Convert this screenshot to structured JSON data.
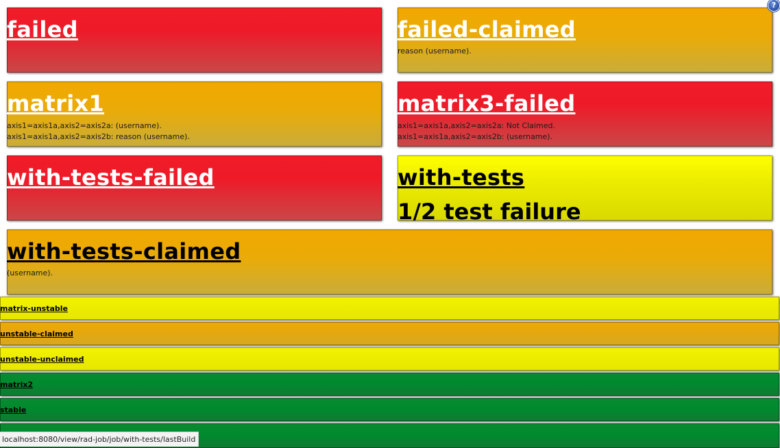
{
  "help_icon": {
    "glyph": "?"
  },
  "big_tiles": [
    {
      "name": "failed",
      "color": "red",
      "claims": []
    },
    {
      "name": "failed-claimed",
      "color": "orange",
      "claims": [
        "reason (username)."
      ]
    },
    {
      "name": "matrix1",
      "color": "orange",
      "claims": [
        "axis1=axis1a,axis2=axis2a: (username).",
        "axis1=axis1a,axis2=axis2b: reason (username)."
      ]
    },
    {
      "name": "matrix3-failed",
      "color": "red",
      "claims": [
        "axis1=axis1a,axis2=axis2a: Not Claimed.",
        "axis1=axis1a,axis2=axis2b: (username)."
      ]
    },
    {
      "name": "with-tests-failed",
      "color": "red",
      "claims": []
    },
    {
      "name": "with-tests",
      "color": "yellow",
      "failures": "1/2 test failure"
    },
    {
      "name": "with-tests-claimed",
      "color": "orange",
      "claims": [
        "(username)."
      ]
    }
  ],
  "small_tiles": [
    {
      "name": "matrix-unstable",
      "color": "yellow"
    },
    {
      "name": "unstable-claimed",
      "color": "orange"
    },
    {
      "name": "unstable-unclaimed",
      "color": "yellow"
    },
    {
      "name": "matrix2",
      "color": "green"
    },
    {
      "name": "stable",
      "color": "green"
    },
    {
      "name": "",
      "color": "green"
    }
  ],
  "status_bar": {
    "url": "localhost:8080/view/rad-job/job/with-tests/lastBuild"
  }
}
